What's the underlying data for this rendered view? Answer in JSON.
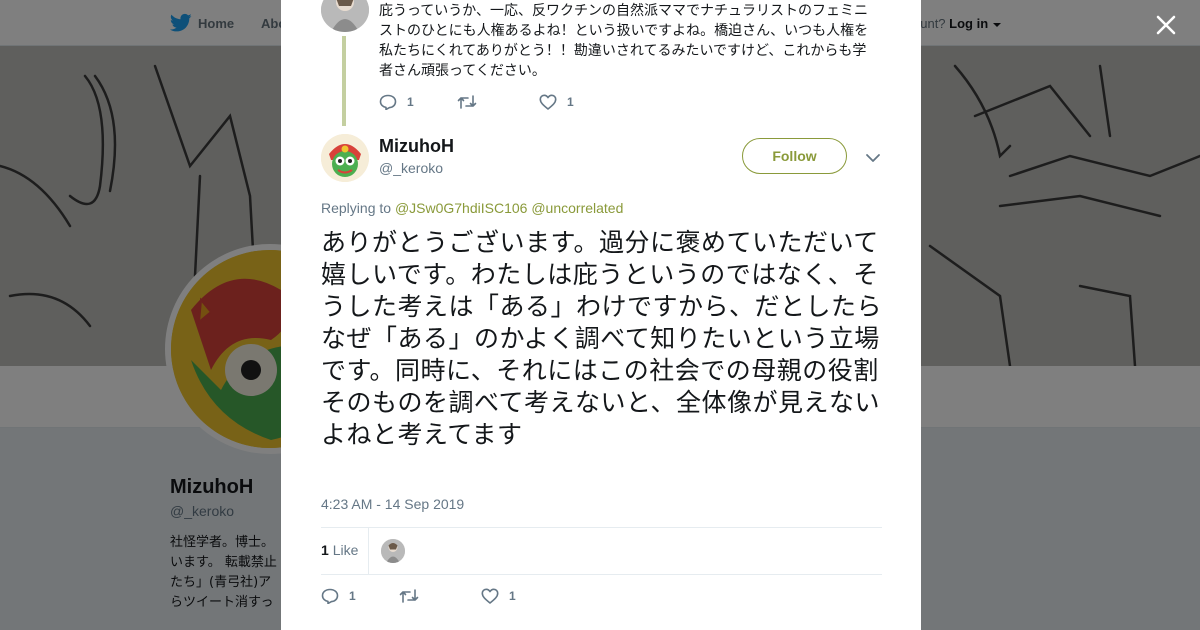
{
  "nav": {
    "home_label": "Home",
    "about_label": "Abo",
    "account_prompt": "ccount?",
    "login_label": "Log in"
  },
  "profile_bg": {
    "name": "MizuhoH",
    "handle": "@_keroko",
    "bio_lines": [
      "社怪学者。博士。",
      "います。 転載禁止",
      "たち」(青弓社)ア",
      "らツイート消すっ"
    ]
  },
  "parent_tweet": {
    "text": "庇うっていうか、一応、反ワクチンの自然派ママでナチュラリストのフェミニストのひとにも人権あるよね！という扱いですよね。橋迫さん、いつも人権を私たちにくれてありがとう！！勘違いされてるみたいですけど、これからも学者さん頑張ってください。",
    "reply_count": "1",
    "retweet_count": "",
    "like_count": "1"
  },
  "tweet": {
    "author_name": "MizuhoH",
    "author_handle": "@_keroko",
    "follow_label": "Follow",
    "replying_prefix": "Replying to",
    "replying_to": [
      "@JSw0G7hdiISC106",
      "@uncorrelated"
    ],
    "text": "ありがとうございます。過分に褒めていただいて嬉しいです。わたしは庇うというのではなく、そうした考えは「ある」わけですから、だとしたらなぜ「ある」のかよく調べて知りたいという立場です。同時に、それにはこの社会での母親の役割そのものを調べて考えないと、全体像が見えないよねと考えてます",
    "timestamp": "4:23 AM - 14 Sep 2019",
    "likes_count": "1",
    "likes_label": "Like",
    "reply_count": "1",
    "retweet_count": "",
    "like_count": "1"
  },
  "colors": {
    "accent": "#8a9a3a",
    "text": "#14171a",
    "muted": "#657786",
    "twitter_blue": "#1da1f2"
  },
  "icons": [
    "twitter-bird-icon",
    "close-icon",
    "reply-icon",
    "retweet-icon",
    "heart-icon",
    "chevron-down-icon"
  ]
}
